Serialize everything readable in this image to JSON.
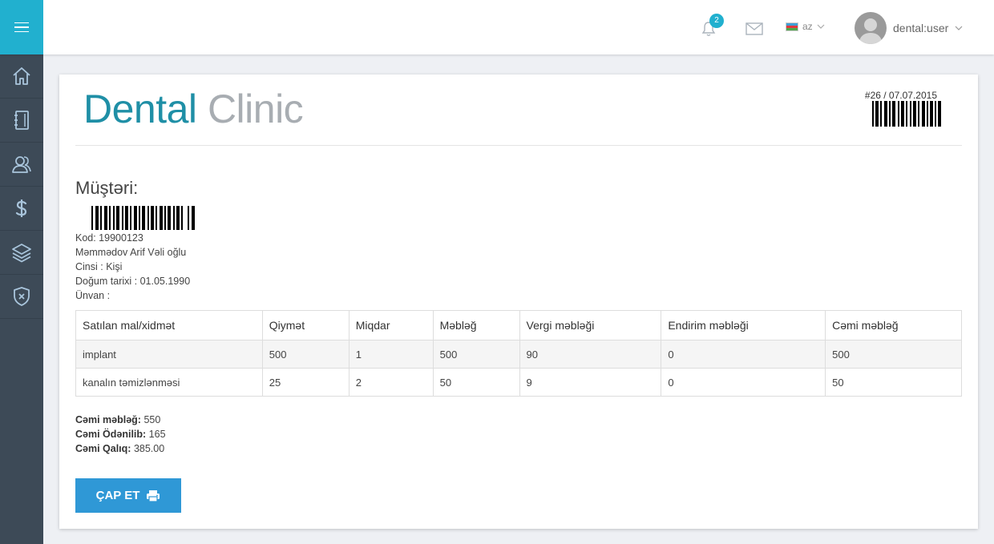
{
  "topbar": {
    "notification_count": "2",
    "language": "az",
    "user_name": "dental:user"
  },
  "sidebar": {
    "items": [
      {
        "icon": "home-icon"
      },
      {
        "icon": "notebook-icon"
      },
      {
        "icon": "users-icon"
      },
      {
        "icon": "dollar-icon"
      },
      {
        "icon": "layers-icon"
      },
      {
        "icon": "shield-icon"
      }
    ]
  },
  "invoice": {
    "logo_part1": "Dental",
    "logo_part2": "Clinic",
    "number_date": "#26 / 07.07.2015",
    "customer_title": "Müştəri:",
    "kod": "Kod: 19900123",
    "name": "Məmmədov Arif Vəli oğlu",
    "gender": "Cinsi : Kişi",
    "birth": "Doğum tarixi : 01.05.1990",
    "address": "Ünvan :"
  },
  "table": {
    "headers": [
      "Satılan mal/xidmət",
      "Qiymət",
      "Miqdar",
      "Məbləğ",
      "Vergi məbləği",
      "Endirim məbləği",
      "Cəmi məbləğ"
    ],
    "rows": [
      [
        "implant",
        "500",
        "1",
        "500",
        "90",
        "0",
        "500"
      ],
      [
        "kanalın təmizlənməsi",
        "25",
        "2",
        "50",
        "9",
        "0",
        "50"
      ]
    ]
  },
  "totals": {
    "total_label": "Cəmi məbləğ:",
    "total_value": " 550",
    "paid_label": "Cəmi Ödənilib:",
    "paid_value": " 165",
    "remaining_label": "Cəmi Qalıq:",
    "remaining_value": " 385.00"
  },
  "print_button": "ÇAP ET",
  "colors": {
    "accent": "#21b0cf",
    "sidebar": "#3d4a57",
    "button": "#2f98d6",
    "logo_primary": "#1f8fa6",
    "logo_secondary": "#a8adb2"
  }
}
